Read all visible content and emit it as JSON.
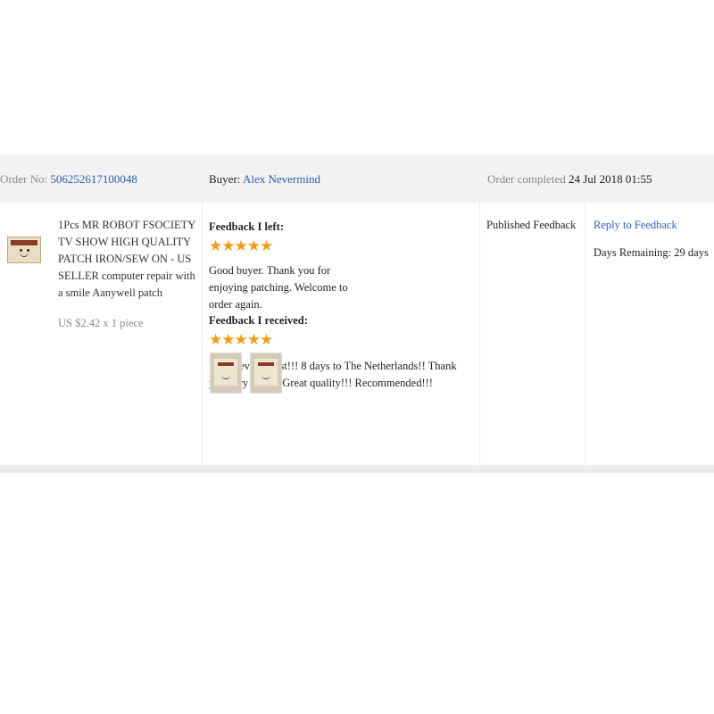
{
  "header": {
    "order_no_label": "Order No:",
    "order_no": "506252617100048",
    "buyer_label": "Buyer:",
    "buyer_name": "Alex Nevermind",
    "completed_label": "Order completed",
    "completed_date": "24 Jul 2018 01:55"
  },
  "product": {
    "title": "1Pcs MR ROBOT FSOCIETY TV SHOW HIGH QUALITY PATCH IRON/SEW ON - US SELLER computer repair with a smile Aanywell patch",
    "price": "US $2.42 x 1 piece"
  },
  "feedback_left": {
    "label": "Feedback I left:",
    "rating": 5,
    "stars": "★★★★★",
    "text": "Good buyer. Thank you for enjoying patching. Welcome to order again."
  },
  "feedback_received": {
    "label": "Feedback I received:",
    "rating": 5,
    "stars": "★★★★★",
    "text": "Unbelievable fast!!! 8 days to The Netherlands!! Thank you very much! Great quality!!! Recommended!!!",
    "photo_count": 2
  },
  "status": {
    "label": "Published Feedback"
  },
  "actions": {
    "reply_label": "Reply to Feedback",
    "days_remaining": "Days Remaining: 29 days"
  },
  "colors": {
    "link": "#2a5fb5",
    "star": "#f39c12",
    "header_bg": "#f2f2f2"
  }
}
